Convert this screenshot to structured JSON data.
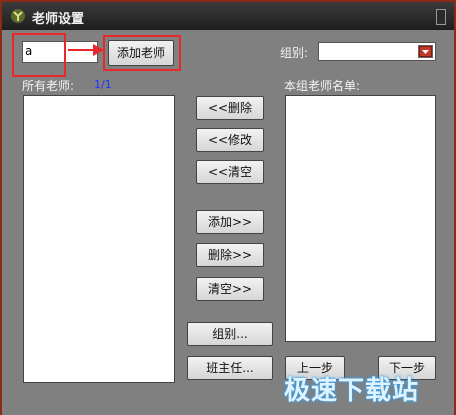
{
  "window": {
    "title": "老师设置"
  },
  "teacher_input": {
    "value": "a"
  },
  "add_teacher_button": "添加老师",
  "group_label": "组别:",
  "group_select": {
    "value": ""
  },
  "all_teachers_label": "所有老师:",
  "all_teachers_count": "1/1",
  "group_teachers_label": "本组老师名单:",
  "buttons": {
    "delete_left": "<<删除",
    "modify_left": "<<修改",
    "clear_left": "<<清空",
    "add_right": "添加>>",
    "delete_right": "删除>>",
    "clear_right": "清空>>",
    "group": "组别...",
    "head_teacher": "班主任...",
    "prev": "上一步",
    "next": "下一步"
  },
  "watermark": "极速下载站",
  "colors": {
    "annotation": "#e8282a",
    "count": "#1e36ff"
  }
}
